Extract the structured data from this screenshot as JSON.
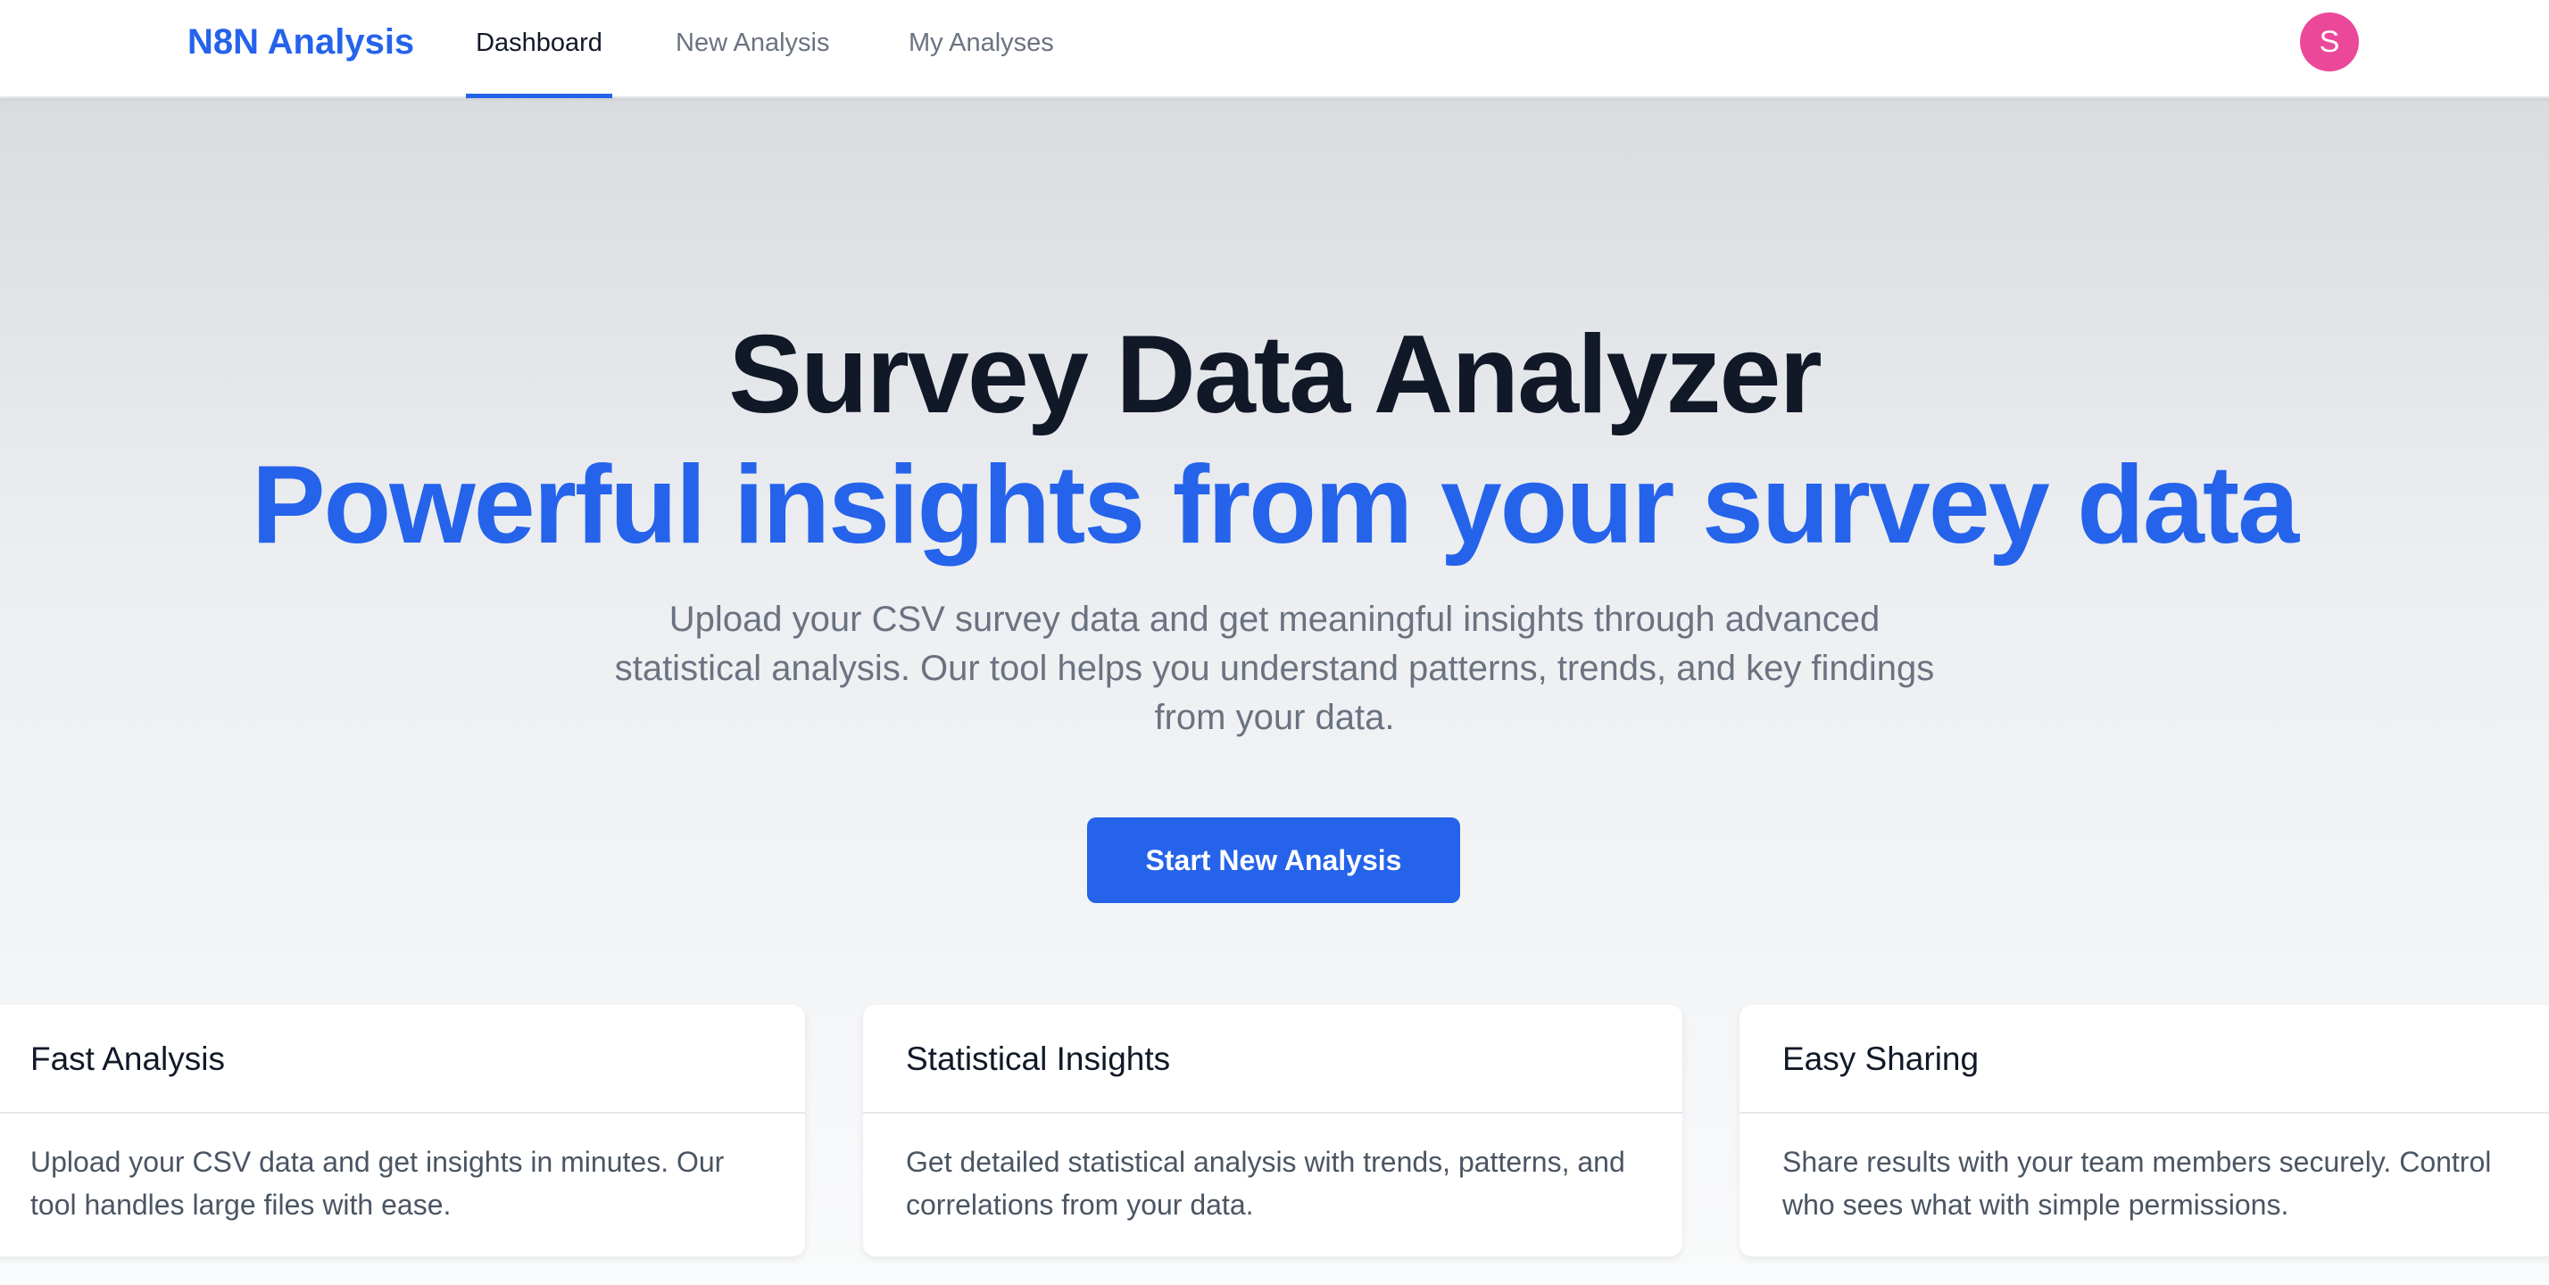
{
  "nav": {
    "brand": "N8N Analysis",
    "links": [
      {
        "label": "Dashboard",
        "active": true
      },
      {
        "label": "New Analysis",
        "active": false
      },
      {
        "label": "My Analyses",
        "active": false
      }
    ],
    "avatar_initial": "S"
  },
  "hero": {
    "title": "Survey Data Analyzer",
    "subtitle": "Powerful insights from your survey data",
    "description": "Upload your CSV survey data and get meaningful insights through advanced statistical analysis. Our tool helps you understand patterns, trends, and key findings from your data.",
    "cta_label": "Start New Analysis"
  },
  "features": [
    {
      "title": "Fast Analysis",
      "body": "Upload your CSV data and get insights in minutes. Our tool handles large files with ease."
    },
    {
      "title": "Statistical Insights",
      "body": "Get detailed statistical analysis with trends, patterns, and correlations from your data."
    },
    {
      "title": "Easy Sharing",
      "body": "Share results with your team members securely. Control who sees what with simple permissions."
    }
  ],
  "colors": {
    "accent": "#2563eb",
    "avatar": "#ec4899",
    "heading": "#111827",
    "muted": "#6b7280"
  }
}
